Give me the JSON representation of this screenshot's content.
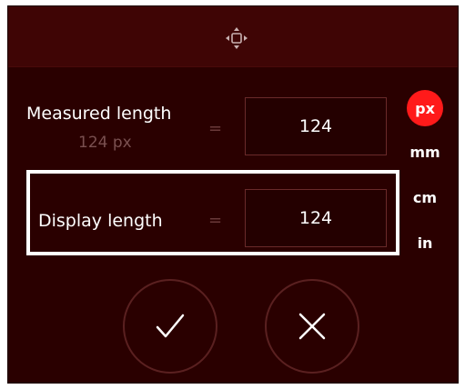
{
  "measured": {
    "label": "Measured length",
    "sub_value": "124 px",
    "equals": "=",
    "value": "124"
  },
  "display": {
    "label": "Display length",
    "equals": "=",
    "value": "124"
  },
  "units": {
    "active": "px",
    "options": [
      "mm",
      "cm",
      "in"
    ]
  },
  "colors": {
    "background": "#2a0000",
    "titlebar": "#3f0505",
    "accent": "#ff1a1a"
  }
}
